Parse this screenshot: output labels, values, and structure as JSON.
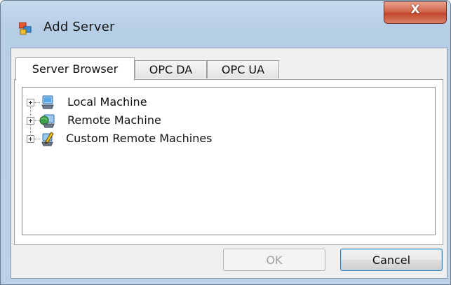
{
  "window": {
    "title": "Add Server",
    "close_glyph": "X"
  },
  "tabs": [
    {
      "label": "Server Browser",
      "active": true
    },
    {
      "label": "OPC DA",
      "active": false
    },
    {
      "label": "OPC UA",
      "active": false
    }
  ],
  "tree": {
    "nodes": [
      {
        "label": "Local Machine",
        "icon": "local-computer-icon"
      },
      {
        "label": "Remote Machine",
        "icon": "network-computer-icon"
      },
      {
        "label": "Custom Remote Machines",
        "icon": "custom-computer-edit-icon"
      }
    ]
  },
  "buttons": {
    "ok_label": "OK",
    "cancel_label": "Cancel"
  },
  "colors": {
    "close_button": "#c2462a",
    "window_frame": "#b6cde6",
    "default_button_border": "#3c7fb1"
  }
}
